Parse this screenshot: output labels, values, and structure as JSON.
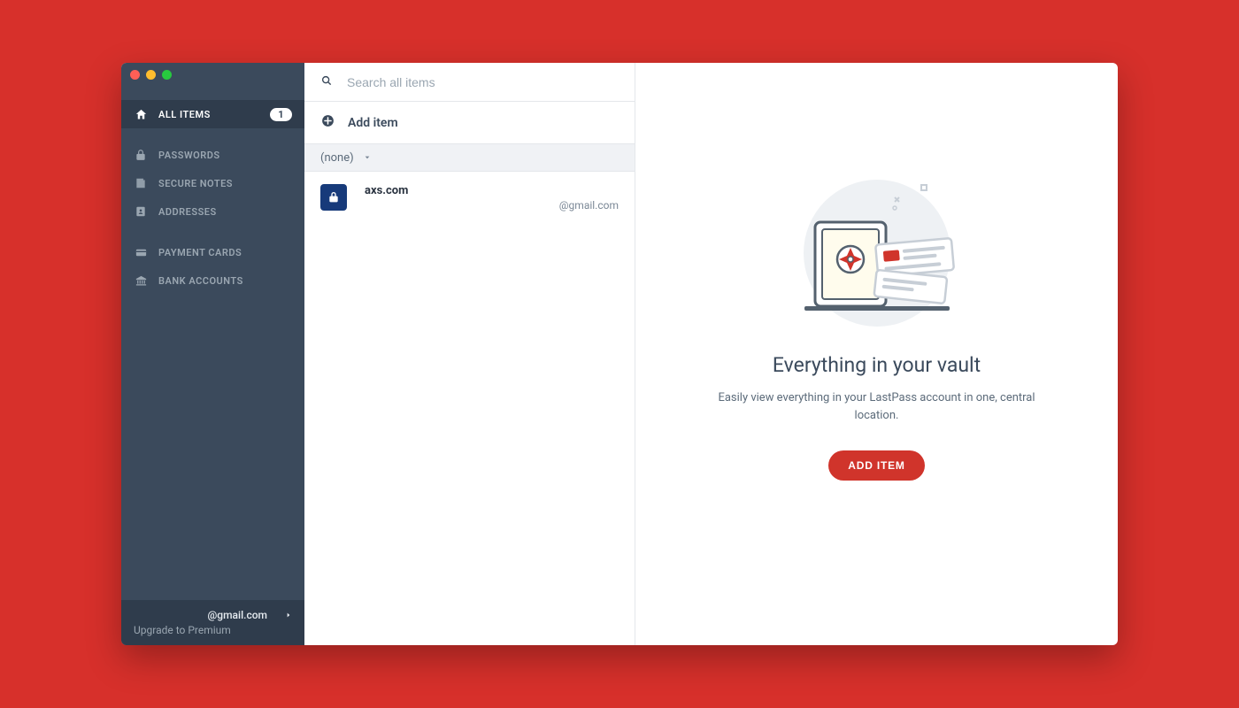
{
  "sidebar": {
    "items": [
      {
        "label": "ALL ITEMS",
        "badge": "1"
      },
      {
        "label": "PASSWORDS"
      },
      {
        "label": "SECURE NOTES"
      },
      {
        "label": "ADDRESSES"
      },
      {
        "label": "PAYMENT CARDS"
      },
      {
        "label": "BANK ACCOUNTS"
      }
    ],
    "footer_email": "@gmail.com",
    "upgrade_text": "Upgrade to Premium"
  },
  "search": {
    "placeholder": "Search all items"
  },
  "add_bar": {
    "label": "Add item"
  },
  "group_header": "(none)",
  "items": [
    {
      "title": "axs.com",
      "subtitle": "@gmail.com"
    }
  ],
  "empty_state": {
    "title": "Everything in your vault",
    "body": "Easily view everything in your LastPass account in one, central location.",
    "button": "ADD ITEM"
  }
}
